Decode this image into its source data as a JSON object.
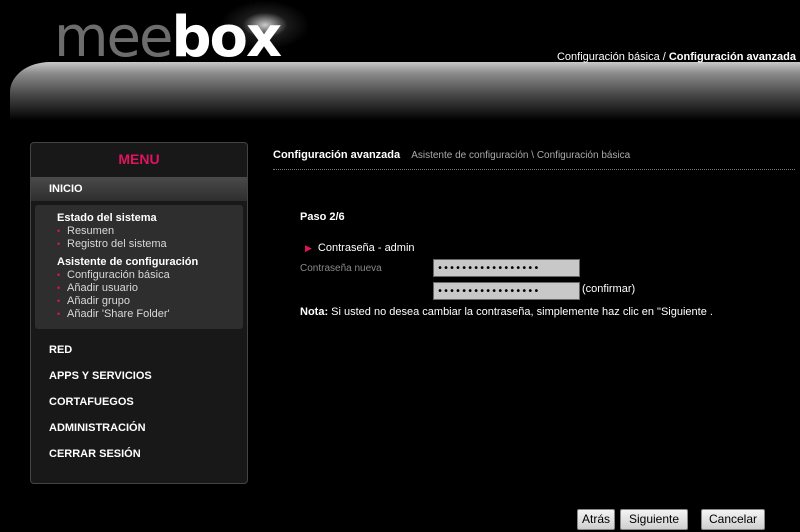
{
  "header": {
    "logo_mee": "mee",
    "logo_box": "box",
    "nav_basic": "Configuración básica",
    "nav_separator": " / ",
    "nav_advanced": "Configuración avanzada"
  },
  "sidebar": {
    "title": "MENU",
    "active_item": "INICIO",
    "groups": [
      {
        "heading": "Estado del sistema",
        "items": [
          "Resumen",
          "Registro del sistema"
        ]
      },
      {
        "heading": "Asistente de configuración",
        "items": [
          "Configuración básica",
          "Añadir usuario",
          "Añadir grupo",
          "Añadir 'Share Folder'"
        ]
      }
    ],
    "bullet": "•",
    "main_items": [
      "RED",
      "APPS Y SERVICIOS",
      "CORTAFUEGOS",
      "ADMINISTRACIÓN",
      "CERRAR SESIÓN"
    ]
  },
  "content": {
    "breadcrumb_title": "Configuración avanzada",
    "breadcrumb_path": "Asistente de configuración \\ Configuración básica",
    "step": "Paso 2/6",
    "section_marker": "▶",
    "section_title": "Contraseña - admin",
    "new_password_label": "Contraseña nueva",
    "password_value": "•••••••••••••••••",
    "confirm_value": "•••••••••••••••••",
    "confirm_label": "(confirmar)",
    "note_label": "Nota:",
    "note_text": " Si usted no desea cambiar la contraseña, simplemente haz clic en \"Siguiente ."
  },
  "buttons": {
    "back": "Atrás",
    "next": "Siguiente",
    "cancel": "Cancelar"
  },
  "colors": {
    "accent": "#e0135e",
    "background": "#000000"
  }
}
